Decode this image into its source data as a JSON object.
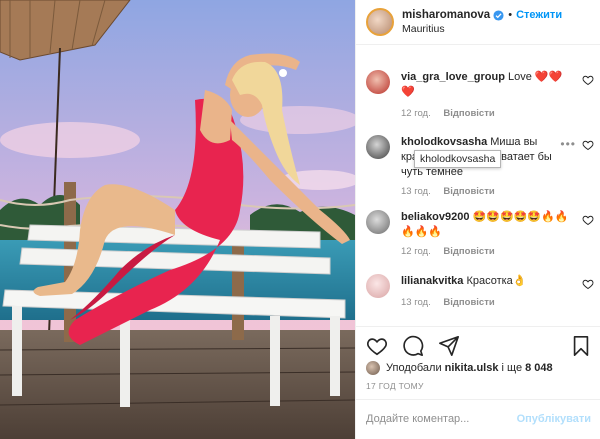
{
  "header": {
    "username": "misharomanova",
    "follow_label": "Стежити",
    "dot": "•",
    "location": "Mauritius"
  },
  "comments": [
    {
      "username": "via_gra_love_group",
      "text": "Love ❤️❤️❤️",
      "time": "12 год.",
      "reply_label": "Відповісти",
      "avatar_color": "#c4402f"
    },
    {
      "username": "kholodkovsasha",
      "text": "Миша вы красавица!!!Но не хватает бы чуть темнее",
      "time": "13 год.",
      "reply_label": "Відповісти",
      "avatar_color": "#4a4a4a"
    },
    {
      "username": "beliakov9200",
      "text": "🤩🤩🤩🤩🤩🔥🔥🔥🔥🔥",
      "time": "12 год.",
      "reply_label": "Відповісти",
      "avatar_color": "#7a7a7a"
    },
    {
      "username": "lilianakvitka",
      "text": "Красотка👌",
      "time": "13 год.",
      "reply_label": "Відповісти",
      "avatar_color": "#e7c2c2"
    }
  ],
  "tooltip": "kholodkovsasha",
  "likes": {
    "prefix": "Уподобали",
    "user": "nikita.ulsk",
    "suffix": "і ще",
    "count": "8 048"
  },
  "time_ago": "17 ГОД ТОМУ",
  "add_comment": {
    "placeholder": "Додайте коментар...",
    "publish_label": "Опублікувати"
  },
  "colors": {
    "accent": "#0095f6",
    "dress": "#e8244f",
    "sky_top": "#9bb2e6",
    "sea": "#2e8fa8"
  }
}
